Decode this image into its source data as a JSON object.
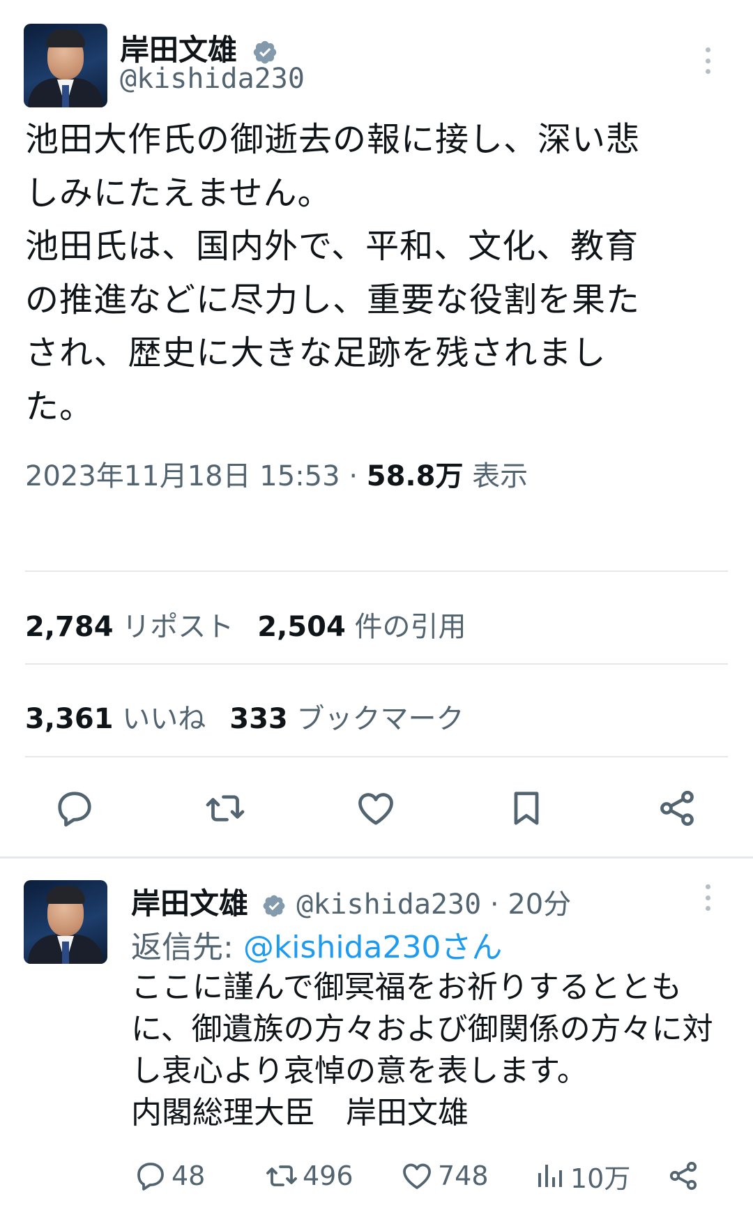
{
  "tweet": {
    "display_name": "岸田文雄",
    "handle": "@kishida230",
    "body": "池田大作氏の御逝去の報に接し、深い悲\nしみにたえません。\n池田氏は、国内外で、平和、文化、教育\nの推進などに尽力し、重要な役割を果た\nされ、歴史に大きな足跡を残されまし\nた。",
    "timestamp": "2023年11月18日 15:53",
    "separator": "·",
    "views_count": "58.8万",
    "views_label": "表示"
  },
  "stats": {
    "reposts_count": "2,784",
    "reposts_label": "リポスト",
    "quotes_count": "2,504",
    "quotes_label": "件の引用",
    "likes_count": "3,361",
    "likes_label": "いいね",
    "bookmarks_count": "333",
    "bookmarks_label": "ブックマーク"
  },
  "actions": [
    "reply-icon",
    "repost-icon",
    "like-icon",
    "bookmark-icon",
    "share-icon"
  ],
  "reply": {
    "display_name": "岸田文雄",
    "handle": "@kishida230",
    "time": "· 20分",
    "reply_to_prefix": "返信先: ",
    "reply_to_handle": "@kishida230さん",
    "body": "ここに謹んで御冥福をお祈りするととも\nに、御遺族の方々および御関係の方々に対\nし衷心より哀悼の意を表します。\n内閣総理大臣　岸田文雄",
    "replies": "48",
    "reposts": "496",
    "likes": "748",
    "views": "10万"
  },
  "colors": {
    "accent": "#1d9bf0",
    "verified": "#829aab",
    "secondary_text": "#536471",
    "divider": "#e4e8eb"
  }
}
